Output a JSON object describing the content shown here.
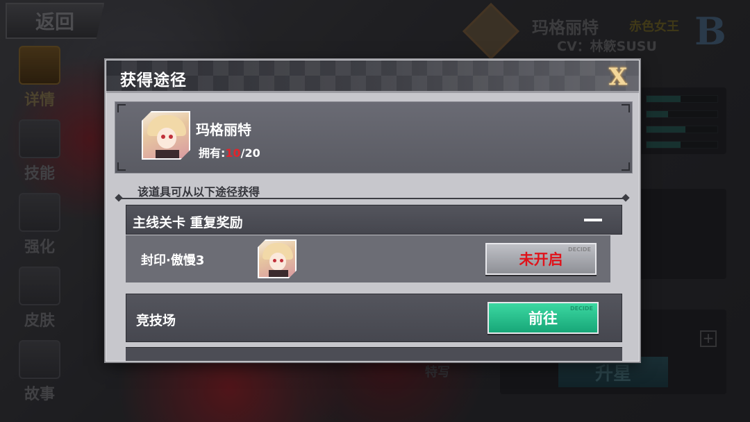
{
  "background": {
    "back_label": "返回",
    "side_tabs": [
      {
        "label": "详情",
        "icon": "sunburst-icon"
      },
      {
        "label": "技能",
        "icon": "sword-icon"
      },
      {
        "label": "强化",
        "icon": "figure-icon"
      },
      {
        "label": "皮肤",
        "icon": "dress-icon"
      },
      {
        "label": "故事",
        "icon": "triangle-book-icon"
      }
    ],
    "character_name": "玛格丽特",
    "character_title": "赤色女王",
    "cv": "CV：林簌SUSU",
    "rank": "B",
    "stat_fills": [
      0.48,
      0.3,
      0.55,
      0.48
    ],
    "special_label": "特写",
    "upgrade_label": "升星",
    "plus_label": "+"
  },
  "dialog": {
    "title": "获得途径",
    "close_label": "X",
    "item": {
      "name": "玛格丽特",
      "owned_label": "拥有:",
      "owned_current": "10",
      "owned_separator": "/",
      "owned_max": "20"
    },
    "sources_label": "该道具可从以下途径获得",
    "sources": [
      {
        "label": "主线关卡 重复奖励",
        "collapse_label": "—",
        "stages": [
          {
            "label": "封印·傲慢3",
            "button": "未开启",
            "button_deco": "DECIDE"
          }
        ]
      },
      {
        "label": "竞技场",
        "button": "前往",
        "button_deco": "DECIDE"
      }
    ]
  }
}
